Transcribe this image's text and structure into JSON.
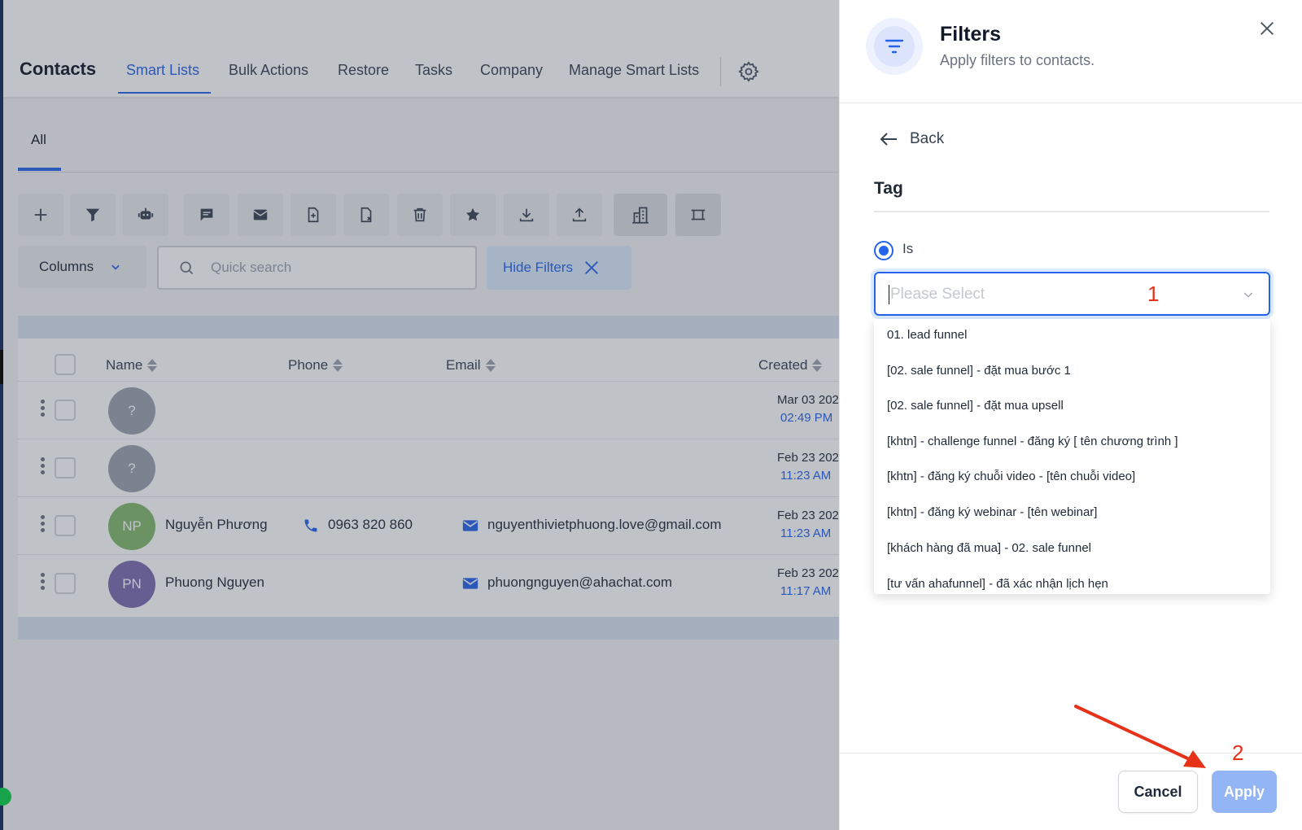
{
  "header": {
    "title": "Contacts",
    "tabs": [
      "Smart Lists",
      "Bulk Actions",
      "Restore",
      "Tasks",
      "Company",
      "Manage Smart Lists"
    ]
  },
  "subtabs": {
    "all": "All"
  },
  "toolbar": {
    "columns_label": "Columns",
    "search_placeholder": "Quick search",
    "hide_filters_label": "Hide Filters"
  },
  "table": {
    "headers": {
      "name": "Name",
      "phone": "Phone",
      "email": "Email",
      "created": "Created"
    },
    "rows": [
      {
        "initials": "?",
        "name": "",
        "phone": "",
        "email": "",
        "date": "Mar 03 202",
        "time": "02:49 PM",
        "avatar_color": "#9ca3af"
      },
      {
        "initials": "?",
        "name": "",
        "phone": "",
        "email": "",
        "date": "Feb 23 202",
        "time": "11:23 AM",
        "avatar_color": "#9ca3af"
      },
      {
        "initials": "NP",
        "name": "Nguyễn Phương",
        "phone": "0963 820 860",
        "email": "nguyenthivietphuong.love@gmail.com",
        "date": "Feb 23 202",
        "time": "11:23 AM",
        "avatar_color": "#84b86a"
      },
      {
        "initials": "PN",
        "name": "Phuong Nguyen",
        "phone": "",
        "email": "phuongnguyen@ahachat.com",
        "date": "Feb 23 202",
        "time": "11:17 AM",
        "avatar_color": "#7c6bb0"
      }
    ]
  },
  "panel": {
    "title": "Filters",
    "subtitle": "Apply filters to contacts.",
    "back_label": "Back",
    "tag_title": "Tag",
    "radio_label": "Is",
    "select_placeholder": "Please Select",
    "options": [
      "01. lead funnel",
      "[02. sale funnel] - đặt mua bước 1",
      "[02. sale funnel] - đặt mua upsell",
      "[khtn] - challenge funnel - đăng ký [ tên chương trình ]",
      "[khtn] - đăng ký chuỗi video - [tên chuỗi video]",
      "[khtn] - đăng ký webinar - [tên webinar]",
      "[khách hàng đã mua] - 02. sale funnel",
      "[tư vấn ahafunnel] - đã xác nhận lịch hẹn"
    ],
    "cancel_label": "Cancel",
    "apply_label": "Apply"
  },
  "annotations": {
    "step1": "1",
    "step2": "2",
    "color": "#e53219"
  },
  "colors": {
    "accent": "#2563eb",
    "apply_disabled": "#93b4f5"
  }
}
